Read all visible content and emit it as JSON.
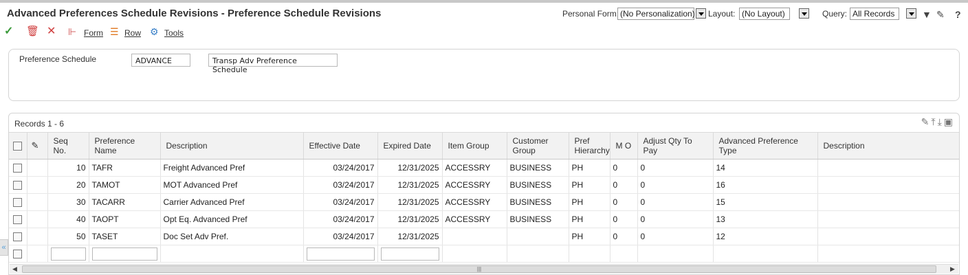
{
  "header": {
    "title": "Advanced Preferences Schedule Revisions - Preference Schedule Revisions",
    "personal_form_label": "Personal Form:",
    "personal_form_value": "(No Personalization)",
    "layout_label": "Layout:",
    "layout_value": "(No Layout)",
    "query_label": "Query:",
    "query_value": "All Records",
    "help_glyph": "?"
  },
  "toolbar": {
    "form_label": "Form",
    "row_label": "Row",
    "tools_label": "Tools"
  },
  "preference_schedule": {
    "label": "Preference Schedule",
    "code": "ADVANCE",
    "description": "Transp Adv Preference Schedule"
  },
  "grid": {
    "records_label": "Records 1 - 6",
    "columns": [
      "Seq No.",
      "Preference Name",
      "Description",
      "Effective Date",
      "Expired Date",
      "Item Group",
      "Customer Group",
      "Pref Hierarchy",
      "M O",
      "Adjust Qty To Pay",
      "Advanced Preference Type",
      "Description"
    ],
    "rows": [
      {
        "seq": "10",
        "name": "TAFR",
        "desc": "Freight Advanced Pref",
        "eff": "03/24/2017",
        "exp": "12/31/2025",
        "item_group": "ACCESSRY",
        "cust_group": "BUSINESS",
        "hier": "PH",
        "mo": "0",
        "adj": "0",
        "adv_type": "14",
        "desc2": ""
      },
      {
        "seq": "20",
        "name": "TAMOT",
        "desc": "MOT Advanced Pref",
        "eff": "03/24/2017",
        "exp": "12/31/2025",
        "item_group": "ACCESSRY",
        "cust_group": "BUSINESS",
        "hier": "PH",
        "mo": "0",
        "adj": "0",
        "adv_type": "16",
        "desc2": ""
      },
      {
        "seq": "30",
        "name": "TACARR",
        "desc": "Carrier Advanced Pref",
        "eff": "03/24/2017",
        "exp": "12/31/2025",
        "item_group": "ACCESSRY",
        "cust_group": "BUSINESS",
        "hier": "PH",
        "mo": "0",
        "adj": "0",
        "adv_type": "15",
        "desc2": ""
      },
      {
        "seq": "40",
        "name": "TAOPT",
        "desc": "Opt Eq. Advanced Pref",
        "eff": "03/24/2017",
        "exp": "12/31/2025",
        "item_group": "ACCESSRY",
        "cust_group": "BUSINESS",
        "hier": "PH",
        "mo": "0",
        "adj": "0",
        "adv_type": "13",
        "desc2": ""
      },
      {
        "seq": "50",
        "name": "TASET",
        "desc": "Doc Set Adv Pref.",
        "eff": "03/24/2017",
        "exp": "12/31/2025",
        "item_group": "",
        "cust_group": "",
        "hier": "PH",
        "mo": "0",
        "adj": "0",
        "adv_type": "12",
        "desc2": ""
      }
    ]
  }
}
